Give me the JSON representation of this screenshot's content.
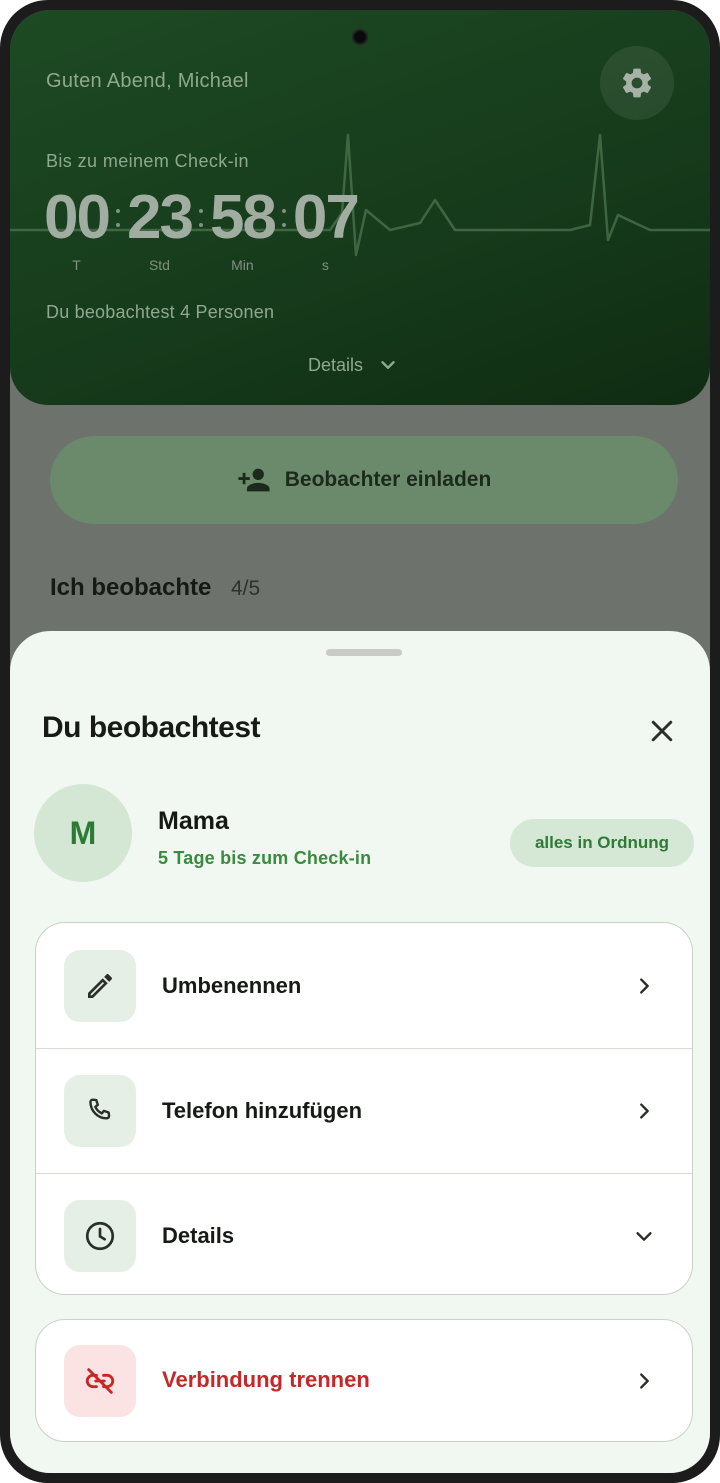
{
  "header": {
    "greeting": "Guten Abend, Michael",
    "checkin_label": "Bis zu meinem Check-in",
    "countdown": [
      {
        "value": "00",
        "unit": "T"
      },
      {
        "value": "23",
        "unit": "Std"
      },
      {
        "value": "58",
        "unit": "Min"
      },
      {
        "value": "07",
        "unit": "s"
      }
    ],
    "watching_text": "Du beobachtest 4 Personen",
    "details_label": "Details",
    "settings_icon": "gear-icon"
  },
  "invite_button": {
    "label": "Beobachter einladen",
    "icon": "person-add-icon"
  },
  "section": {
    "title": "Ich beobachte",
    "count": "4/5"
  },
  "sheet": {
    "title": "Du beobachtest",
    "close_icon": "close-icon",
    "person": {
      "initial": "M",
      "name": "Mama",
      "subtitle": "5 Tage bis zum Check-in",
      "status": "alles in Ordnung"
    },
    "actions": [
      {
        "label": "Umbenennen",
        "icon": "pencil-icon",
        "trailing": "chevron-right-icon"
      },
      {
        "label": "Telefon hinzufügen",
        "icon": "phone-icon",
        "trailing": "chevron-right-icon"
      },
      {
        "label": "Details",
        "icon": "clock-icon",
        "trailing": "chevron-down-icon"
      }
    ],
    "danger_action": {
      "label": "Verbindung trennen",
      "icon": "link-off-icon",
      "trailing": "chevron-right-icon"
    }
  },
  "colors": {
    "header_green": "#1d4a23",
    "accent_green": "#3a8a3f",
    "danger_red": "#c62828",
    "sheet_bg": "#f1f7f1"
  }
}
